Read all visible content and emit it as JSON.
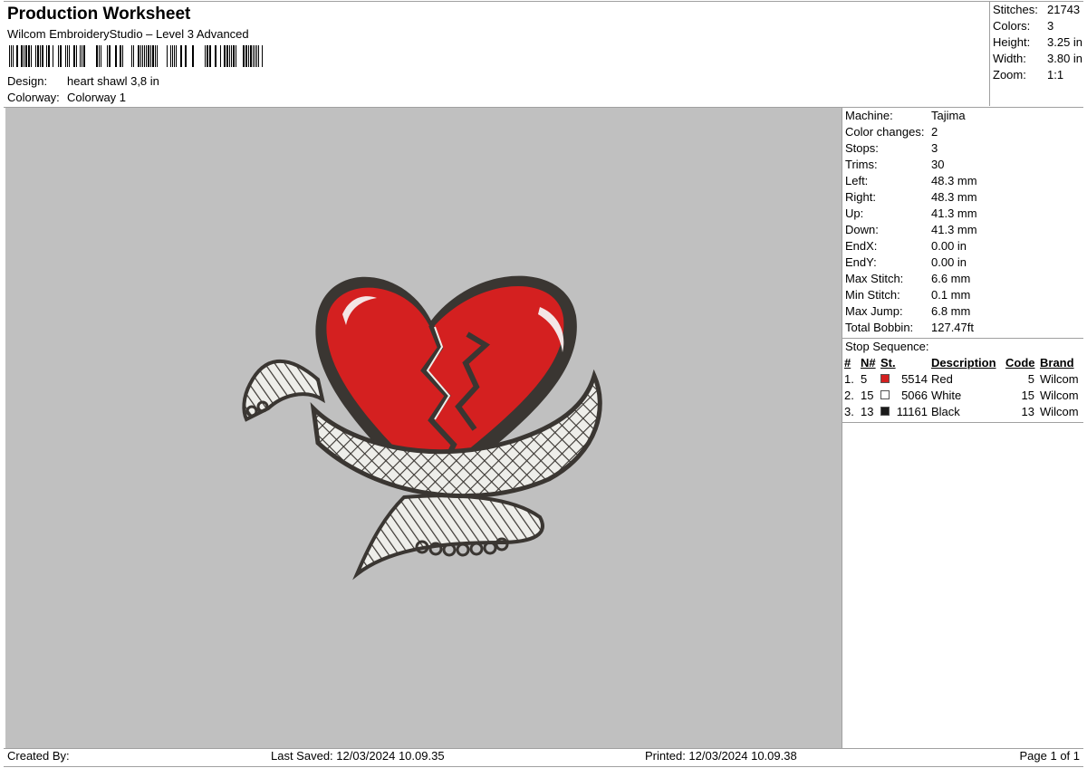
{
  "header": {
    "title": "Production Worksheet",
    "subtitle": "Wilcom EmbroideryStudio – Level 3 Advanced",
    "design_label": "Design:",
    "design_value": "heart shawl 3,8 in",
    "colorway_label": "Colorway:",
    "colorway_value": "Colorway 1"
  },
  "summary": [
    {
      "label": "Stitches:",
      "value": "21743"
    },
    {
      "label": "Colors:",
      "value": "3"
    },
    {
      "label": "Height:",
      "value": "3.25 in"
    },
    {
      "label": "Width:",
      "value": "3.80 in"
    },
    {
      "label": "Zoom:",
      "value": "1:1"
    }
  ],
  "stats": [
    {
      "label": "Machine:",
      "value": "Tajima"
    },
    {
      "label": "Color changes:",
      "value": "2"
    },
    {
      "label": "Stops:",
      "value": "3"
    },
    {
      "label": "Trims:",
      "value": "30"
    },
    {
      "label": "Left:",
      "value": "48.3 mm"
    },
    {
      "label": "Right:",
      "value": "48.3 mm"
    },
    {
      "label": "Up:",
      "value": "41.3 mm"
    },
    {
      "label": "Down:",
      "value": "41.3 mm"
    },
    {
      "label": "EndX:",
      "value": "0.00 in"
    },
    {
      "label": "EndY:",
      "value": "0.00 in"
    },
    {
      "label": "Max Stitch:",
      "value": "6.6 mm"
    },
    {
      "label": "Min Stitch:",
      "value": "0.1 mm"
    },
    {
      "label": "Max Jump:",
      "value": "6.8 mm"
    },
    {
      "label": "Total Bobbin:",
      "value": "127.47ft"
    }
  ],
  "stop_sequence": {
    "title": "Stop Sequence:",
    "columns": [
      "#",
      "N#",
      "St.",
      "Description",
      "Code",
      "Brand"
    ],
    "rows": [
      {
        "idx": "1.",
        "n": "5",
        "color": "#d42020",
        "st": "5514",
        "desc": "Red",
        "code": "5",
        "brand": "Wilcom"
      },
      {
        "idx": "2.",
        "n": "15",
        "color": "#ffffff",
        "st": "5066",
        "desc": "White",
        "code": "15",
        "brand": "Wilcom"
      },
      {
        "idx": "3.",
        "n": "13",
        "color": "#1a1a1a",
        "st": "11161",
        "desc": "Black",
        "code": "13",
        "brand": "Wilcom"
      }
    ]
  },
  "footer": {
    "created_by": "Created By:",
    "last_saved": "Last Saved: 12/03/2024 10.09.35",
    "printed": "Printed: 12/03/2024 10.09.38",
    "page": "Page 1 of 1"
  },
  "colors": {
    "canvas": "#c0c0c0",
    "thread_red": "#d42020",
    "thread_white": "#f0f0ee",
    "thread_black": "#3a3632"
  }
}
